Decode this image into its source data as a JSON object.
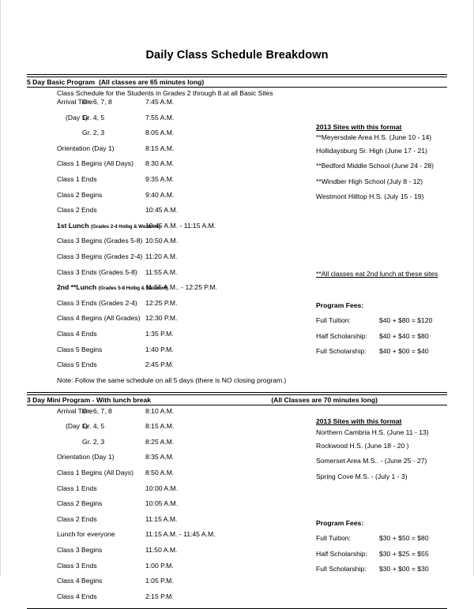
{
  "document": {
    "title": "Daily Class Schedule Breakdown"
  },
  "section1": {
    "band_title": "5 Day Basic Program",
    "band_inline": "(All classes are 65 minutes long)",
    "subtitle": "Class Schedule for the Students in Grades 2 through 8 at all Basic Sites",
    "arrival": {
      "label1": "Arrival Time",
      "label2": "(Day 1)",
      "grades": [
        "Gr. 6, 7, 8",
        "Gr. 4, 5",
        "Gr. 2, 3"
      ],
      "times": [
        "7:45 A.M.",
        "7:55 A.M.",
        "8:05 A.M."
      ]
    },
    "rows": [
      {
        "event": "Orientation  (Day 1)",
        "time": "8:15 A.M."
      },
      {
        "event": "Class 1 Begins  (All Days)",
        "time": "8:30 A.M."
      },
      {
        "event": "Class 1 Ends",
        "time": "9:35 A.M."
      },
      {
        "event": "Class 2 Begins",
        "time": "9:40 A.M."
      },
      {
        "event": "Class 2 Ends",
        "time": "10:45 A.M."
      },
      {
        "event": "1st Lunch",
        "event_small": "(Grades 2-4 Holbg & Westmnt)",
        "bold": true,
        "time": "10:45 A.M. - 11:15 A.M."
      },
      {
        "event": "Class 3 Begins (Grades 5-8)",
        "time": "10:50 A.M."
      },
      {
        "event": "Class 3 Begins (Grades 2-4)",
        "time": "11:20 A.M."
      },
      {
        "event": "Class 3 Ends (Grades 5-8)",
        "time": "11:55  A.M."
      },
      {
        "event": "2nd **Lunch",
        "event_small": "(Grades 5-8 Holbg & Westmnt)",
        "bold": true,
        "time": "11:55 A.M.. - 12:25 P.M."
      },
      {
        "event": "Class 3 Ends (Grades 2-4)",
        "time": "12:25 P.M."
      },
      {
        "event": "Class 4 Begins (All Grades)",
        "time": "12:30 P.M."
      },
      {
        "event": "Class 4 Ends",
        "time": "1:35 P.M."
      },
      {
        "event": "Class 5 Begins",
        "time": "1:40 P.M."
      },
      {
        "event": "Class 5 Ends",
        "time": "2:45 P.M."
      }
    ],
    "note": "Note:  Follow the same schedule on all 5 days (there is NO closing program.)",
    "sites_heading": "2013 Sites with this format",
    "sites": [
      "**Meyersdale Area H.S. (June 10 - 14)",
      "Hollidaysburg Sr. High (June 17 - 21)",
      "**Bedford Middle School (June 24 - 28)",
      "**Windber High School (July 8 - 12)",
      "Westmont Hilltop H.S. (July 15 - 19)"
    ],
    "lunch_footnote": "**All classes eat 2nd lunch at these sites",
    "fees_title": "Program Fees:",
    "fees": [
      {
        "name": "Full Tuition:",
        "value": "$40 + $80 = $120"
      },
      {
        "name": "Half Scholarship:",
        "value": "$40 + $40 = $80"
      },
      {
        "name": "Full Scholarship:",
        "value": "$40 + $00 = $40"
      }
    ]
  },
  "section2": {
    "band_title": "3 Day Mini Program - With lunch break",
    "band_note": "(All Classes are 70 minutes long)",
    "arrival": {
      "label1": "Arrival Time",
      "label2": "(Day 1)",
      "grades": [
        "Gr. 6, 7, 8",
        "Gr. 4, 5",
        "Gr. 2, 3"
      ],
      "times": [
        "8:10 A.M.",
        "8:15 A.M.",
        "8:25 A.M."
      ]
    },
    "rows": [
      {
        "event": "Orientation  (Day 1)",
        "time": "8:35 A.M."
      },
      {
        "event": "Class 1 Begins  (All Days)",
        "time": "8:50 A.M."
      },
      {
        "event": "Class 1 Ends",
        "time": "10:00 A.M."
      },
      {
        "event": "Class 2 Begins",
        "time": "10:05 A.M."
      },
      {
        "event": "Class 2 Ends",
        "time": "11:15 A.M."
      },
      {
        "event": "Lunch for everyone",
        "time": "11:15 A.M. - 11:45 A.M."
      },
      {
        "event": "Class 3 Begins",
        "time": "11:50 A.M."
      },
      {
        "event": "Class 3 Ends",
        "time": "1:00 P.M."
      },
      {
        "event": "Class 4 Begins",
        "time": "1:05 P.M."
      },
      {
        "event": "Class 4 Ends",
        "time": "2:15 P.M."
      }
    ],
    "sites_heading": "2013 Sites with this format",
    "sites": [
      "Northern Cambria H.S. (June 11 - 13)",
      "Rockwood H.S. (June 18 - 20 )",
      "Somerset Area M.S.. - (June 25 - 27)",
      "Spring Cove M.S. - (July 1 - 3)"
    ],
    "fees_title": "Program Fees:",
    "fees": [
      {
        "name": "Full Tuition:",
        "value": "$30 + $50 = $80"
      },
      {
        "name": "Half Scholarship:",
        "value": "$30 + $25 = $55"
      },
      {
        "name": "Full Scholarship:",
        "value": "$30 + $00 = $30"
      }
    ]
  }
}
